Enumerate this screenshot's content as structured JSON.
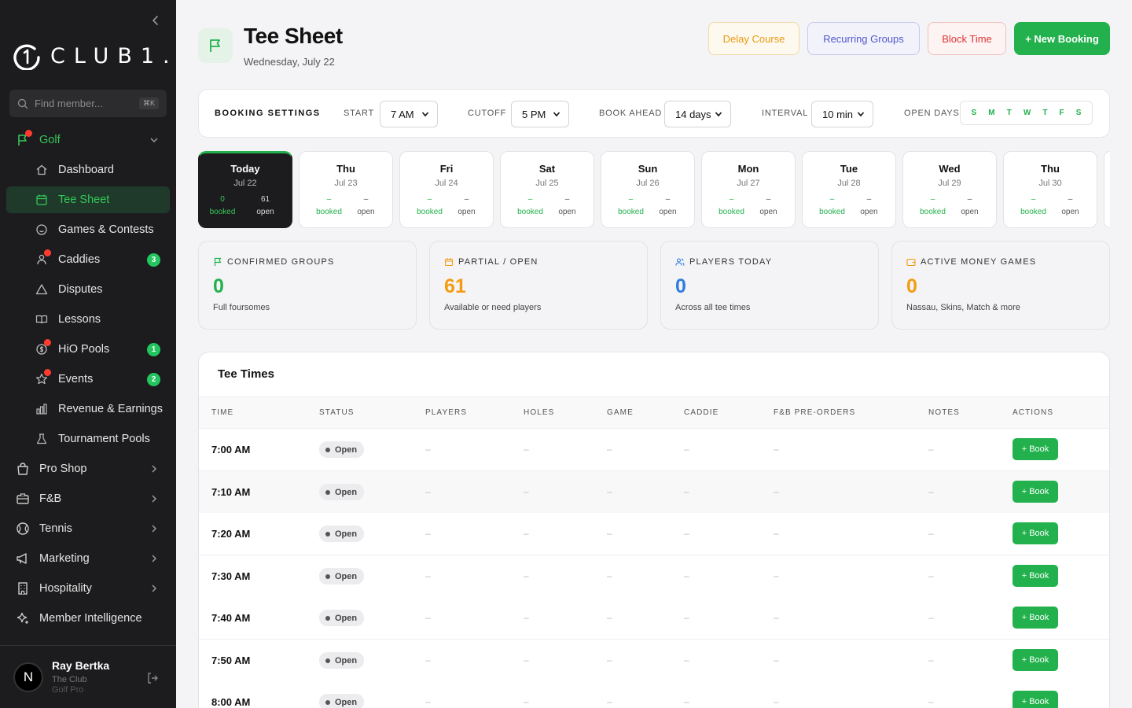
{
  "app": {
    "brand": "CLUB1.",
    "search_placeholder": "Find member...",
    "search_shortcut": "⌘K"
  },
  "sidebar": {
    "golf_label": "Golf",
    "golf_items": [
      {
        "label": "Dashboard",
        "icon": "home-icon"
      },
      {
        "label": "Tee Sheet",
        "icon": "calendar-icon",
        "active": true
      },
      {
        "label": "Games & Contests",
        "icon": "smiley-icon"
      },
      {
        "label": "Caddies",
        "icon": "caddie-icon",
        "count": "3"
      },
      {
        "label": "Disputes",
        "icon": "warning-icon"
      },
      {
        "label": "Lessons",
        "icon": "book-icon"
      },
      {
        "label": "HiO Pools",
        "icon": "dollar-icon",
        "count": "1"
      },
      {
        "label": "Events",
        "icon": "star-icon",
        "count": "2"
      },
      {
        "label": "Revenue & Earnings",
        "icon": "bar-chart-icon"
      },
      {
        "label": "Tournament Pools",
        "icon": "flask-icon"
      }
    ],
    "sections": [
      {
        "label": "Pro Shop",
        "icon": "shopping-bag-icon"
      },
      {
        "label": "F&B",
        "icon": "briefcase-icon"
      },
      {
        "label": "Tennis",
        "icon": "tennis-icon"
      },
      {
        "label": "Marketing",
        "icon": "megaphone-icon"
      },
      {
        "label": "Hospitality",
        "icon": "building-icon"
      },
      {
        "label": "Member Intelligence",
        "icon": "sparkle-icon"
      }
    ],
    "user": {
      "initial": "N",
      "name": "Ray Bertka",
      "club": "The Club",
      "role": "Golf Pro"
    }
  },
  "header": {
    "title": "Tee Sheet",
    "date": "Wednesday, July 22",
    "buttons": {
      "delay": "Delay Course",
      "recurring": "Recurring Groups",
      "block": "Block Time",
      "new": "+ New Booking"
    }
  },
  "settings": {
    "title": "BOOKING SETTINGS",
    "start_label": "START",
    "start_value": "7 AM",
    "cutoff_label": "CUTOFF",
    "cutoff_value": "5 PM",
    "book_ahead_label": "BOOK AHEAD",
    "book_ahead_value": "14 days",
    "interval_label": "INTERVAL",
    "interval_value": "10 min",
    "open_days_label": "OPEN DAYS",
    "open_days": [
      "S",
      "M",
      "T",
      "W",
      "T",
      "F",
      "S"
    ]
  },
  "days": [
    {
      "name": "Today",
      "date": "Jul 22",
      "booked": "0",
      "open": "61",
      "booked_label": "booked",
      "open_label": "open"
    },
    {
      "name": "Thu",
      "date": "Jul 23",
      "booked": "–",
      "open": "–",
      "booked_label": "booked",
      "open_label": "open"
    },
    {
      "name": "Fri",
      "date": "Jul 24",
      "booked": "–",
      "open": "–",
      "booked_label": "booked",
      "open_label": "open"
    },
    {
      "name": "Sat",
      "date": "Jul 25",
      "booked": "–",
      "open": "–",
      "booked_label": "booked",
      "open_label": "open"
    },
    {
      "name": "Sun",
      "date": "Jul 26",
      "booked": "–",
      "open": "–",
      "booked_label": "booked",
      "open_label": "open"
    },
    {
      "name": "Mon",
      "date": "Jul 27",
      "booked": "–",
      "open": "–",
      "booked_label": "booked",
      "open_label": "open"
    },
    {
      "name": "Tue",
      "date": "Jul 28",
      "booked": "–",
      "open": "–",
      "booked_label": "booked",
      "open_label": "open"
    },
    {
      "name": "Wed",
      "date": "Jul 29",
      "booked": "–",
      "open": "–",
      "booked_label": "booked",
      "open_label": "open"
    },
    {
      "name": "Thu",
      "date": "Jul 30",
      "booked": "–",
      "open": "–",
      "booked_label": "booked",
      "open_label": "open"
    }
  ],
  "stats": [
    {
      "label": "CONFIRMED GROUPS",
      "value": "0",
      "desc": "Full foursomes",
      "color": "#22b14c",
      "icon": "flag-icon"
    },
    {
      "label": "PARTIAL / OPEN",
      "value": "61",
      "desc": "Available or need players",
      "color": "#f39c12",
      "icon": "calendar-icon"
    },
    {
      "label": "PLAYERS TODAY",
      "value": "0",
      "desc": "Across all tee times",
      "color": "#2f7de1",
      "icon": "users-icon"
    },
    {
      "label": "ACTIVE MONEY GAMES",
      "value": "0",
      "desc": "Nassau, Skins, Match & more",
      "color": "#f39c12",
      "icon": "wallet-icon"
    }
  ],
  "tee_times": {
    "title": "Tee Times",
    "columns": [
      "TIME",
      "STATUS",
      "PLAYERS",
      "HOLES",
      "GAME",
      "CADDIE",
      "F&B PRE-ORDERS",
      "NOTES",
      "ACTIONS"
    ],
    "empty": "–",
    "book_label": "+ Book",
    "rows": [
      {
        "time": "7:00 AM",
        "status": "Open"
      },
      {
        "time": "7:10 AM",
        "status": "Open"
      },
      {
        "time": "7:20 AM",
        "status": "Open"
      },
      {
        "time": "7:30 AM",
        "status": "Open"
      },
      {
        "time": "7:40 AM",
        "status": "Open"
      },
      {
        "time": "7:50 AM",
        "status": "Open"
      },
      {
        "time": "8:00 AM",
        "status": "Open"
      }
    ]
  }
}
